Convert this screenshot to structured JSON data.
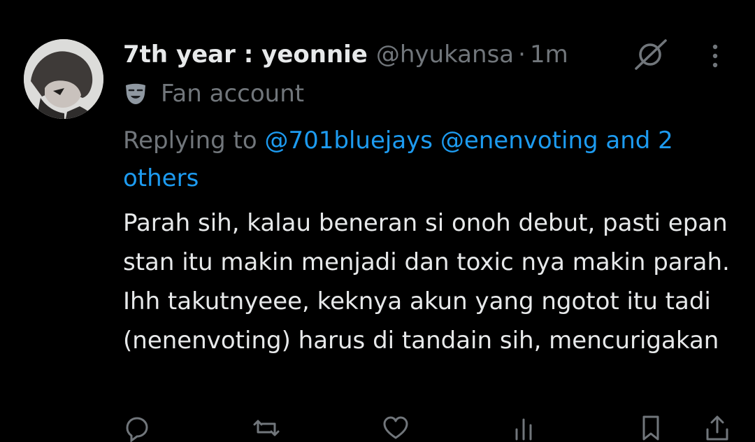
{
  "tweet": {
    "author": {
      "display_name": "7th year : yeonnie",
      "handle": "@hyukansa",
      "separator": "·",
      "time": "1m"
    },
    "label": {
      "icon": "theater-mask-icon",
      "text": "Fan account"
    },
    "replying": {
      "prefix": "Replying to",
      "mention_1": "@701bluejays",
      "mention_2": "@enenvoting",
      "and_others": "and 2 others"
    },
    "body": "Parah sih, kalau beneran si onoh debut, pasti epan stan itu makin menjadi dan toxic nya makin parah. Ihh takutnyeee, keknya akun yang ngotot itu tadi (nenenvoting) harus di tandain sih, mencurigakan",
    "top_icons": [
      "grok-icon",
      "more-icon"
    ],
    "actions": [
      "reply-icon",
      "retweet-icon",
      "like-icon",
      "views-icon",
      "bookmark-icon",
      "share-icon"
    ]
  },
  "colors": {
    "background": "#000000",
    "primary_text": "#e7e9ea",
    "secondary_text": "#71767b",
    "link": "#1d9bf0"
  }
}
